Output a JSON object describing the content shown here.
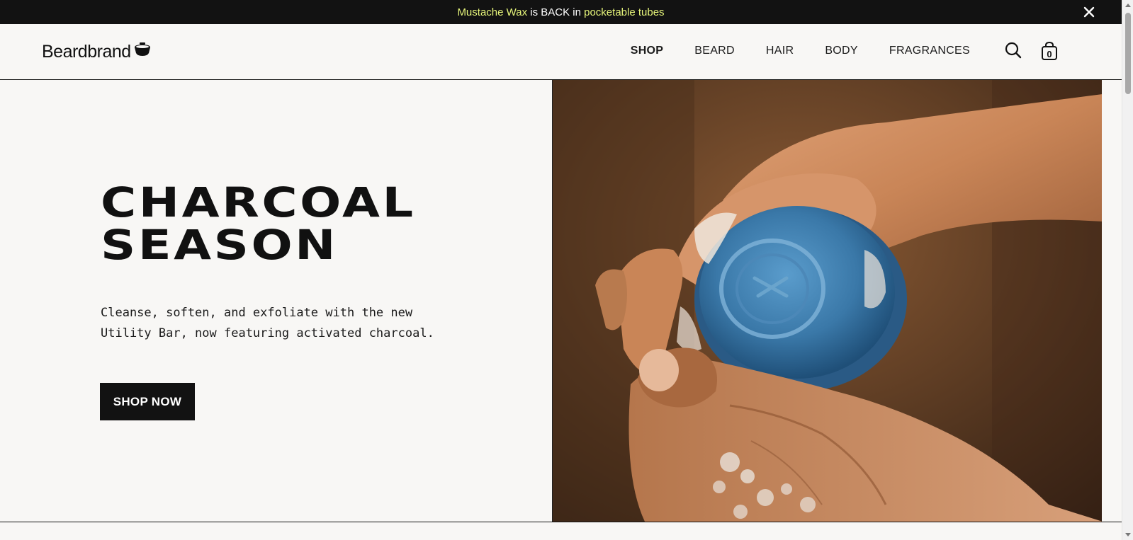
{
  "announcement": {
    "part1": "Mustache Wax",
    "part2": " is BACK in ",
    "part3": "pocketable tubes",
    "highlight_color": "#e6f57a"
  },
  "header": {
    "logo_text": "Beardbrand",
    "nav": [
      "SHOP",
      "BEARD",
      "HAIR",
      "BODY",
      "FRAGRANCES"
    ],
    "active_nav": "SHOP",
    "cart_count": "0"
  },
  "hero": {
    "title": "CHARCOAL\nSEASON",
    "description": "Cleanse, soften, and exfoliate with the new Utility Bar, now featuring activated charcoal.",
    "cta_label": "SHOP NOW"
  },
  "icons": {
    "close": "close-icon",
    "search": "search-icon",
    "cart": "shopping-bag-icon",
    "logo": "pot-icon"
  },
  "colors": {
    "dark": "#121212",
    "background": "#f8f7f5",
    "soap_blue": "#3a78a8"
  }
}
